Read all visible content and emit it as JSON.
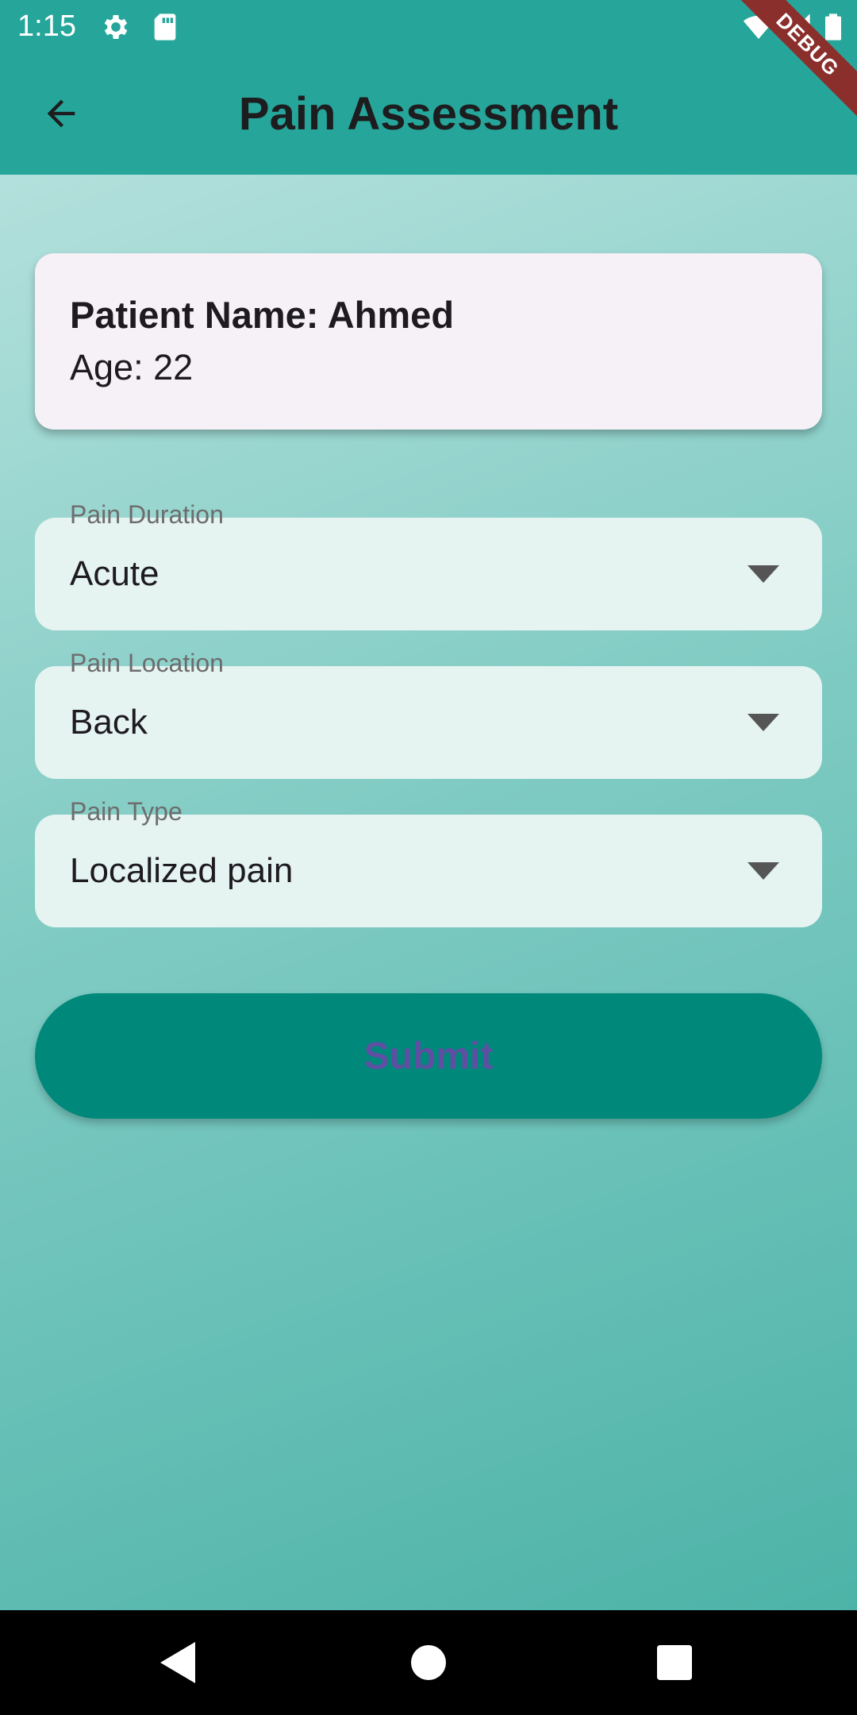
{
  "status_bar": {
    "time": "1:15",
    "icons": [
      "gear-icon",
      "sd-card-icon",
      "wifi-icon",
      "signal-icon",
      "battery-icon"
    ]
  },
  "app_bar": {
    "title": "Pain Assessment",
    "back_icon": "arrow-back-icon",
    "background_color": "#26A69A"
  },
  "debug_banner": {
    "label": "DEBUG"
  },
  "patient": {
    "name_line": "Patient Name: Ahmed",
    "age_line": "Age: 22"
  },
  "form": {
    "pain_duration": {
      "label": "Pain Duration",
      "value": "Acute"
    },
    "pain_location": {
      "label": "Pain Location",
      "value": "Back"
    },
    "pain_type": {
      "label": "Pain Type",
      "value": "Localized pain"
    },
    "submit_label": "Submit"
  },
  "colors": {
    "accent": "#00897B",
    "submit_text": "#5e4fa3",
    "card_background": "#f6f0f7"
  },
  "nav_bar": {
    "icons": [
      "back-triangle-icon",
      "home-circle-icon",
      "recents-square-icon"
    ]
  }
}
